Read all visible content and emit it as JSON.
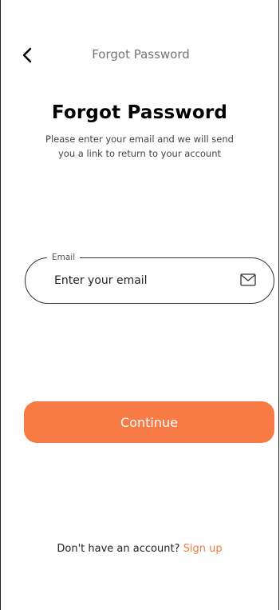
{
  "header": {
    "title": "Forgot Password",
    "back_icon": "chevron-left-icon"
  },
  "main": {
    "title": "Forgot Password",
    "subtitle": "Please enter your email and we will send you a link to return to your account"
  },
  "email": {
    "label": "Email",
    "placeholder": "Enter your email",
    "value": "",
    "icon": "mail-icon"
  },
  "actions": {
    "continue_label": "Continue"
  },
  "footer": {
    "prompt": "Don't have an account?",
    "signup_label": "Sign up"
  },
  "colors": {
    "accent": "#F87B45",
    "link": "#F07B3F"
  }
}
